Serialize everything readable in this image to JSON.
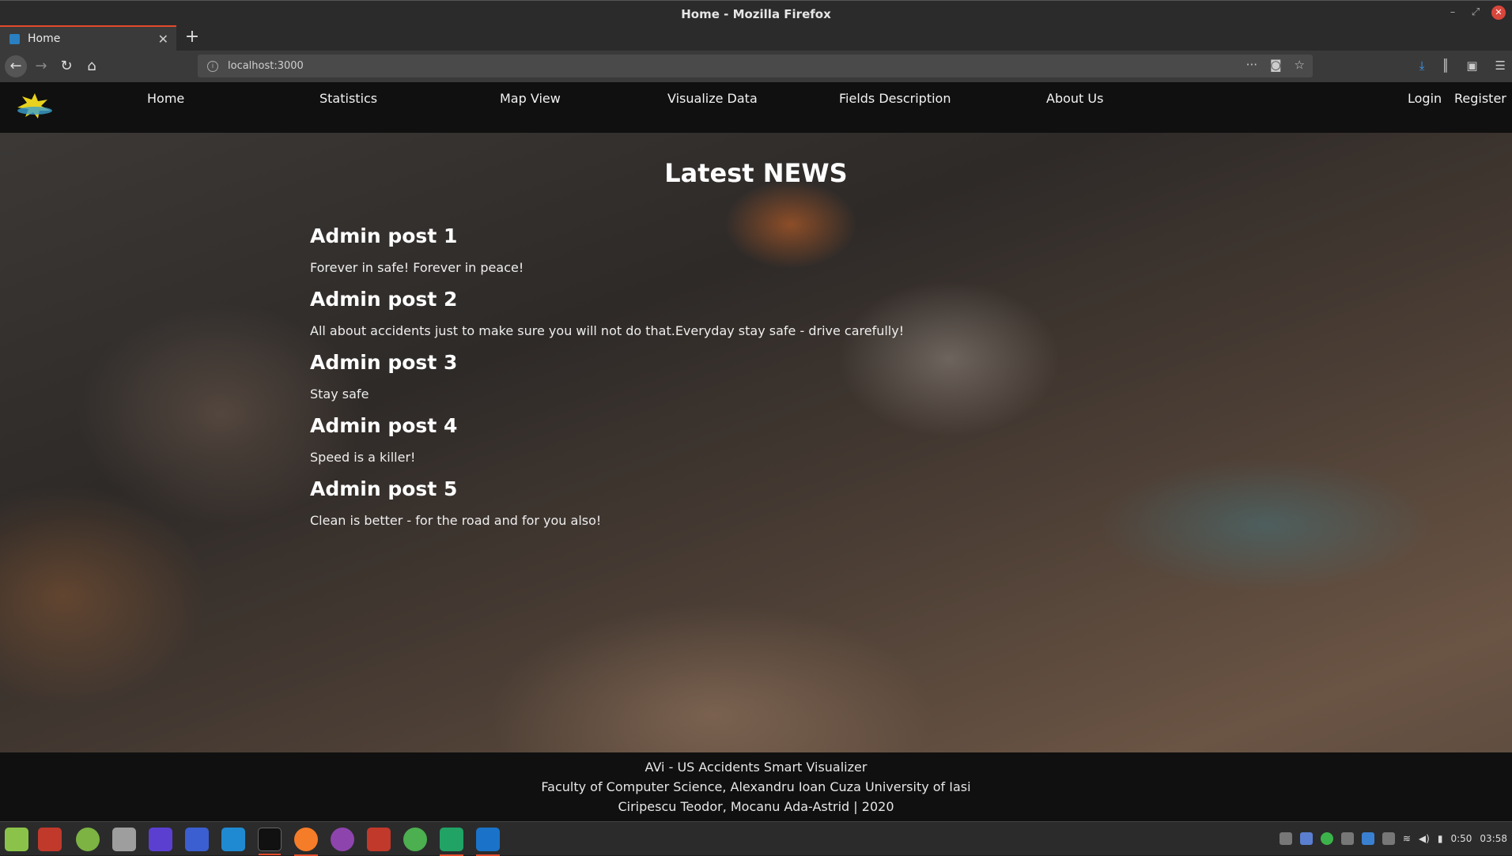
{
  "window": {
    "title": "Home - Mozilla Firefox"
  },
  "browser": {
    "tab": {
      "label": "Home"
    },
    "url": "localhost:3000"
  },
  "site": {
    "nav": [
      "Home",
      "Statistics",
      "Map View",
      "Visualize Data",
      "Fields Description",
      "About Us"
    ],
    "auth": {
      "login": "Login",
      "register": "Register"
    }
  },
  "news": {
    "heading": "Latest NEWS",
    "posts": [
      {
        "title": "Admin post 1",
        "body": "Forever in safe! Forever in peace!"
      },
      {
        "title": "Admin post 2",
        "body": "All about accidents just to make sure you will not do that.Everyday stay safe - drive carefully!"
      },
      {
        "title": "Admin post 3",
        "body": "Stay safe"
      },
      {
        "title": "Admin post 4",
        "body": "Speed is a killer!"
      },
      {
        "title": "Admin post 5",
        "body": "Clean is better - for the road and for you also!"
      }
    ]
  },
  "footer": {
    "line1": "AVi - US Accidents Smart Visualizer",
    "line2": "Faculty of Computer Science, Alexandru Ioan Cuza University of Iasi",
    "line3": "Ciripescu Teodor, Mocanu Ada-Astrid | 2020"
  },
  "taskbar": {
    "icons": [
      "mint-menu-icon",
      "files-icon",
      "terminal-green-icon",
      "settings-icon",
      "intellij-icon",
      "intellij-ce-icon",
      "vscode-icon",
      "terminal-icon",
      "firefox-icon",
      "github-icon",
      "folder-icon",
      "chrome-icon",
      "datagrip-icon",
      "webstorm-icon"
    ],
    "clock": "03:58",
    "battery_time": "0:50"
  }
}
